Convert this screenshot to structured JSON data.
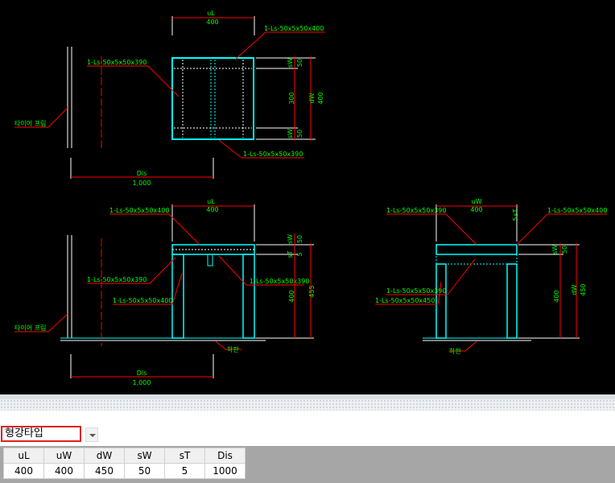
{
  "drawing": {
    "top": {
      "dim_uL_label": "uL",
      "dim_uL_value": "400",
      "callout_a": "1-Ls-50x5x50x400",
      "callout_b": "1-Ls-50x5x50x390",
      "callout_c": "1-Ls-50x5x50x390",
      "dim_sW_top": "sW",
      "dim_50_top": "50",
      "dim_300": "300",
      "dim_dW_label": "dW",
      "dim_dW_value": "400",
      "dim_sW_bot": "sW",
      "dim_50_bot": "50",
      "tire_label": "타이어 프림",
      "dis_label": "Dis",
      "dis_value": "1,000"
    },
    "front": {
      "dim_uL_label": "uL",
      "dim_uL_value": "400",
      "callout_a": "1-Ls-50x5x50x400",
      "callout_b": "1-Ls-50x5x50x390",
      "callout_c": "1-Ls-50x5x50x400",
      "callout_d": "1-Ls-50x5x50x390",
      "dim_sW": "sW",
      "dim_50": "50",
      "dim_sT": "sT",
      "dim_5": "5",
      "dim_400": "400",
      "dim_455": "455",
      "tire_label": "타이어 프림",
      "ground_label": "하판",
      "dis_label": "Dis",
      "dis_value": "1,000"
    },
    "side": {
      "dim_uW_label": "uW",
      "dim_uW_value": "400",
      "dim_sT": "sT",
      "dim_5": "5",
      "callout_a": "1-Ls-50x5x50x390",
      "callout_b": "1-Ls-50x5x50x400",
      "callout_c": "1-Ls-50x5x50x390",
      "callout_d": "1-Ls-50x5x50x450",
      "dim_sW": "sW",
      "dim_50": "50",
      "dim_400": "400",
      "dim_dW": "dW",
      "dim_450": "450",
      "ground_label": "하판"
    }
  },
  "type_selector": {
    "value": "형강타입"
  },
  "params": {
    "headers": [
      "uL",
      "uW",
      "dW",
      "sW",
      "sT",
      "Dis"
    ],
    "values": [
      "400",
      "400",
      "450",
      "50",
      "5",
      "1000"
    ]
  },
  "colors": {
    "cyan": "#00ffff",
    "green": "#00ff00",
    "red": "#ff0000",
    "white": "#ffffff",
    "highlight": "#e02020"
  }
}
